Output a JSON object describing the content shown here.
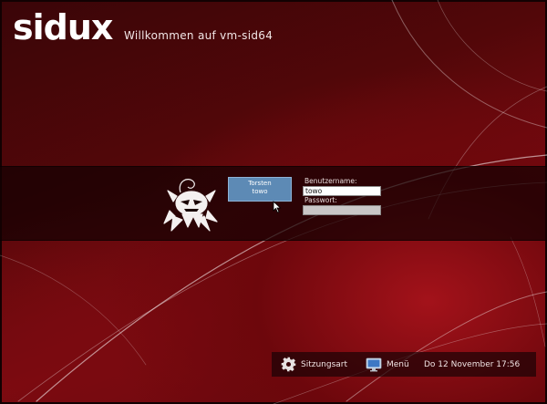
{
  "header": {
    "logo_text": "sidux",
    "welcome": "Willkommen auf vm-sid64"
  },
  "login": {
    "user_entry": {
      "name": "Torsten",
      "login": "towo"
    },
    "username": {
      "label": "Benutzername:",
      "value": "towo"
    },
    "password": {
      "label": "Passwort:",
      "value": ""
    }
  },
  "bottom_bar": {
    "session_label": "Sitzungsart",
    "menu_label": "Menü",
    "clock": "Do 12 November 17:56"
  },
  "colors": {
    "background": "#7e0b11",
    "band": "#140203",
    "user_entry": "#5d8ab5"
  },
  "icons": {
    "session": "gear-icon",
    "menu": "monitor-icon",
    "mascot": "sidux-mascot-icon",
    "pointer": "mouse-pointer-icon"
  }
}
